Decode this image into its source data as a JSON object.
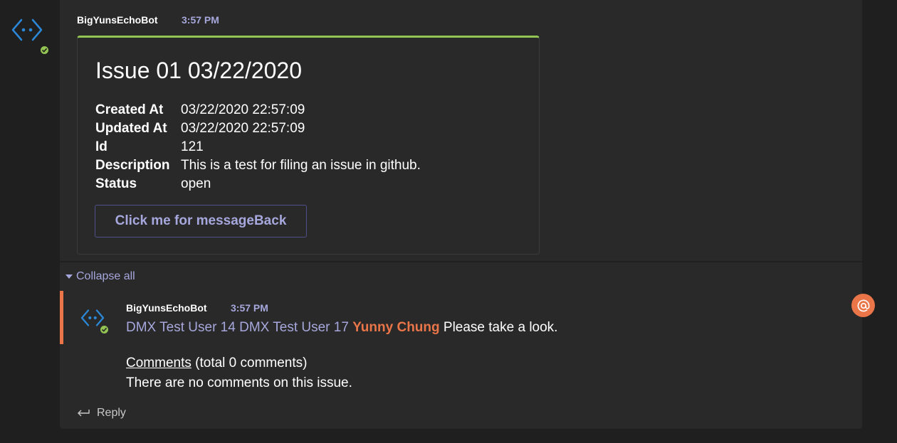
{
  "top_message": {
    "sender": "BigYunsEchoBot",
    "time": "3:57 PM",
    "card": {
      "title": "Issue 01 03/22/2020",
      "facts": [
        {
          "key": "Created At",
          "value": "03/22/2020 22:57:09"
        },
        {
          "key": "Updated At",
          "value": "03/22/2020 22:57:09"
        },
        {
          "key": "Id",
          "value": "121"
        },
        {
          "key": "Description",
          "value": "This is a test for filing an issue in github."
        },
        {
          "key": "Status",
          "value": "open"
        }
      ],
      "button_label": "Click me for messageBack"
    }
  },
  "thread": {
    "collapse_label": "Collapse all",
    "reply": {
      "sender": "BigYunsEchoBot",
      "time": "3:57 PM",
      "mentions": [
        "DMX Test User 14",
        "DMX Test User 17"
      ],
      "highlighted_mention": "Yunny Chung",
      "message_text": "Please take a look.",
      "comments_link": "Comments",
      "comments_count_text": "(total 0 comments)",
      "comments_empty_text": "There are no comments on this issue."
    },
    "reply_label": "Reply"
  },
  "colors": {
    "accent": "#a6a7dc",
    "mention_me": "#e97548",
    "card_accent": "#92c353",
    "presence": "#92c353"
  },
  "icons": {
    "bot_avatar": "bot-avatar-icon",
    "presence": "available-check-icon",
    "reply": "reply-arrow-icon",
    "at_mention": "at-mention-icon"
  }
}
